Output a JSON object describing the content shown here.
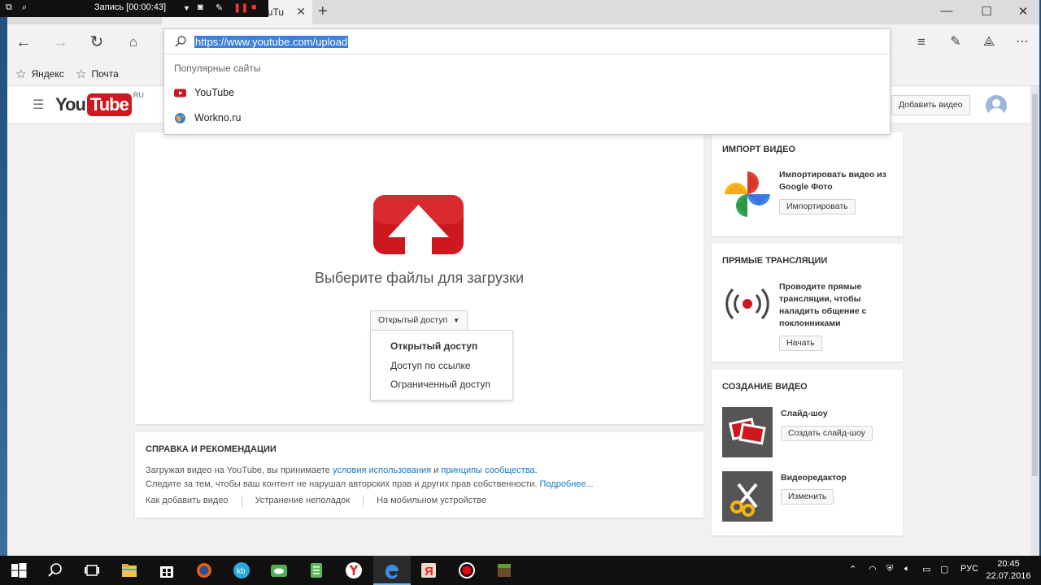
{
  "recorder": {
    "title": "Запись [00:00:43]"
  },
  "browser": {
    "tab_title": "ouTu",
    "address": {
      "url": "https://www.youtube.com/upload",
      "suggestions_heading": "Популярные сайты",
      "suggestions": [
        "YouTube",
        "Workno.ru"
      ]
    },
    "favorites": [
      "Яндекс",
      "Почта"
    ]
  },
  "youtube": {
    "logo_you": "You",
    "logo_tube": "Tube",
    "logo_region": "RU",
    "add_video_label": "Добавить видео",
    "upload": {
      "title": "Выберите файлы для загрузки",
      "privacy_selected": "Открытый доступ",
      "privacy_options": [
        "Открытый доступ",
        "Доступ по ссылке",
        "Ограниченный доступ"
      ]
    },
    "help": {
      "title": "СПРАВКА И РЕКОМЕНДАЦИИ",
      "line1_prefix": "Загружая видео на YouTube, вы принимаете ",
      "line1_link1": "условия использования",
      "line1_middle": " и ",
      "line1_link2": "принципы сообщества",
      "line1_suffix": ".",
      "line2_text": "Следите за тем, чтобы ваш контент не нарушал авторских прав и других прав собственности. ",
      "line2_link": "Подробнее...",
      "links": [
        "Как добавить видео",
        "Устранение неполадок",
        "На мобильном устройстве"
      ]
    },
    "import": {
      "title": "ИМПОРТ ВИДЕО",
      "text": "Импортировать видео из Google Фото",
      "button": "Импортировать"
    },
    "live": {
      "title": "ПРЯМЫЕ ТРАНСЛЯЦИИ",
      "text": "Проводите прямые трансляции, чтобы наладить общение с поклонниками",
      "button": "Начать"
    },
    "create": {
      "title": "СОЗДАНИЕ ВИДЕО",
      "slideshow_label": "Слайд-шоу",
      "slideshow_button": "Создать слайд-шоу",
      "editor_label": "Видеоредактор",
      "editor_button": "Изменить"
    }
  },
  "taskbar": {
    "language": "РУС",
    "time": "20:45",
    "date": "22.07.2016"
  },
  "colors": {
    "youtube_red": "#cc181e",
    "link_blue": "#167ac6",
    "selection_blue": "#3d7fd9"
  }
}
